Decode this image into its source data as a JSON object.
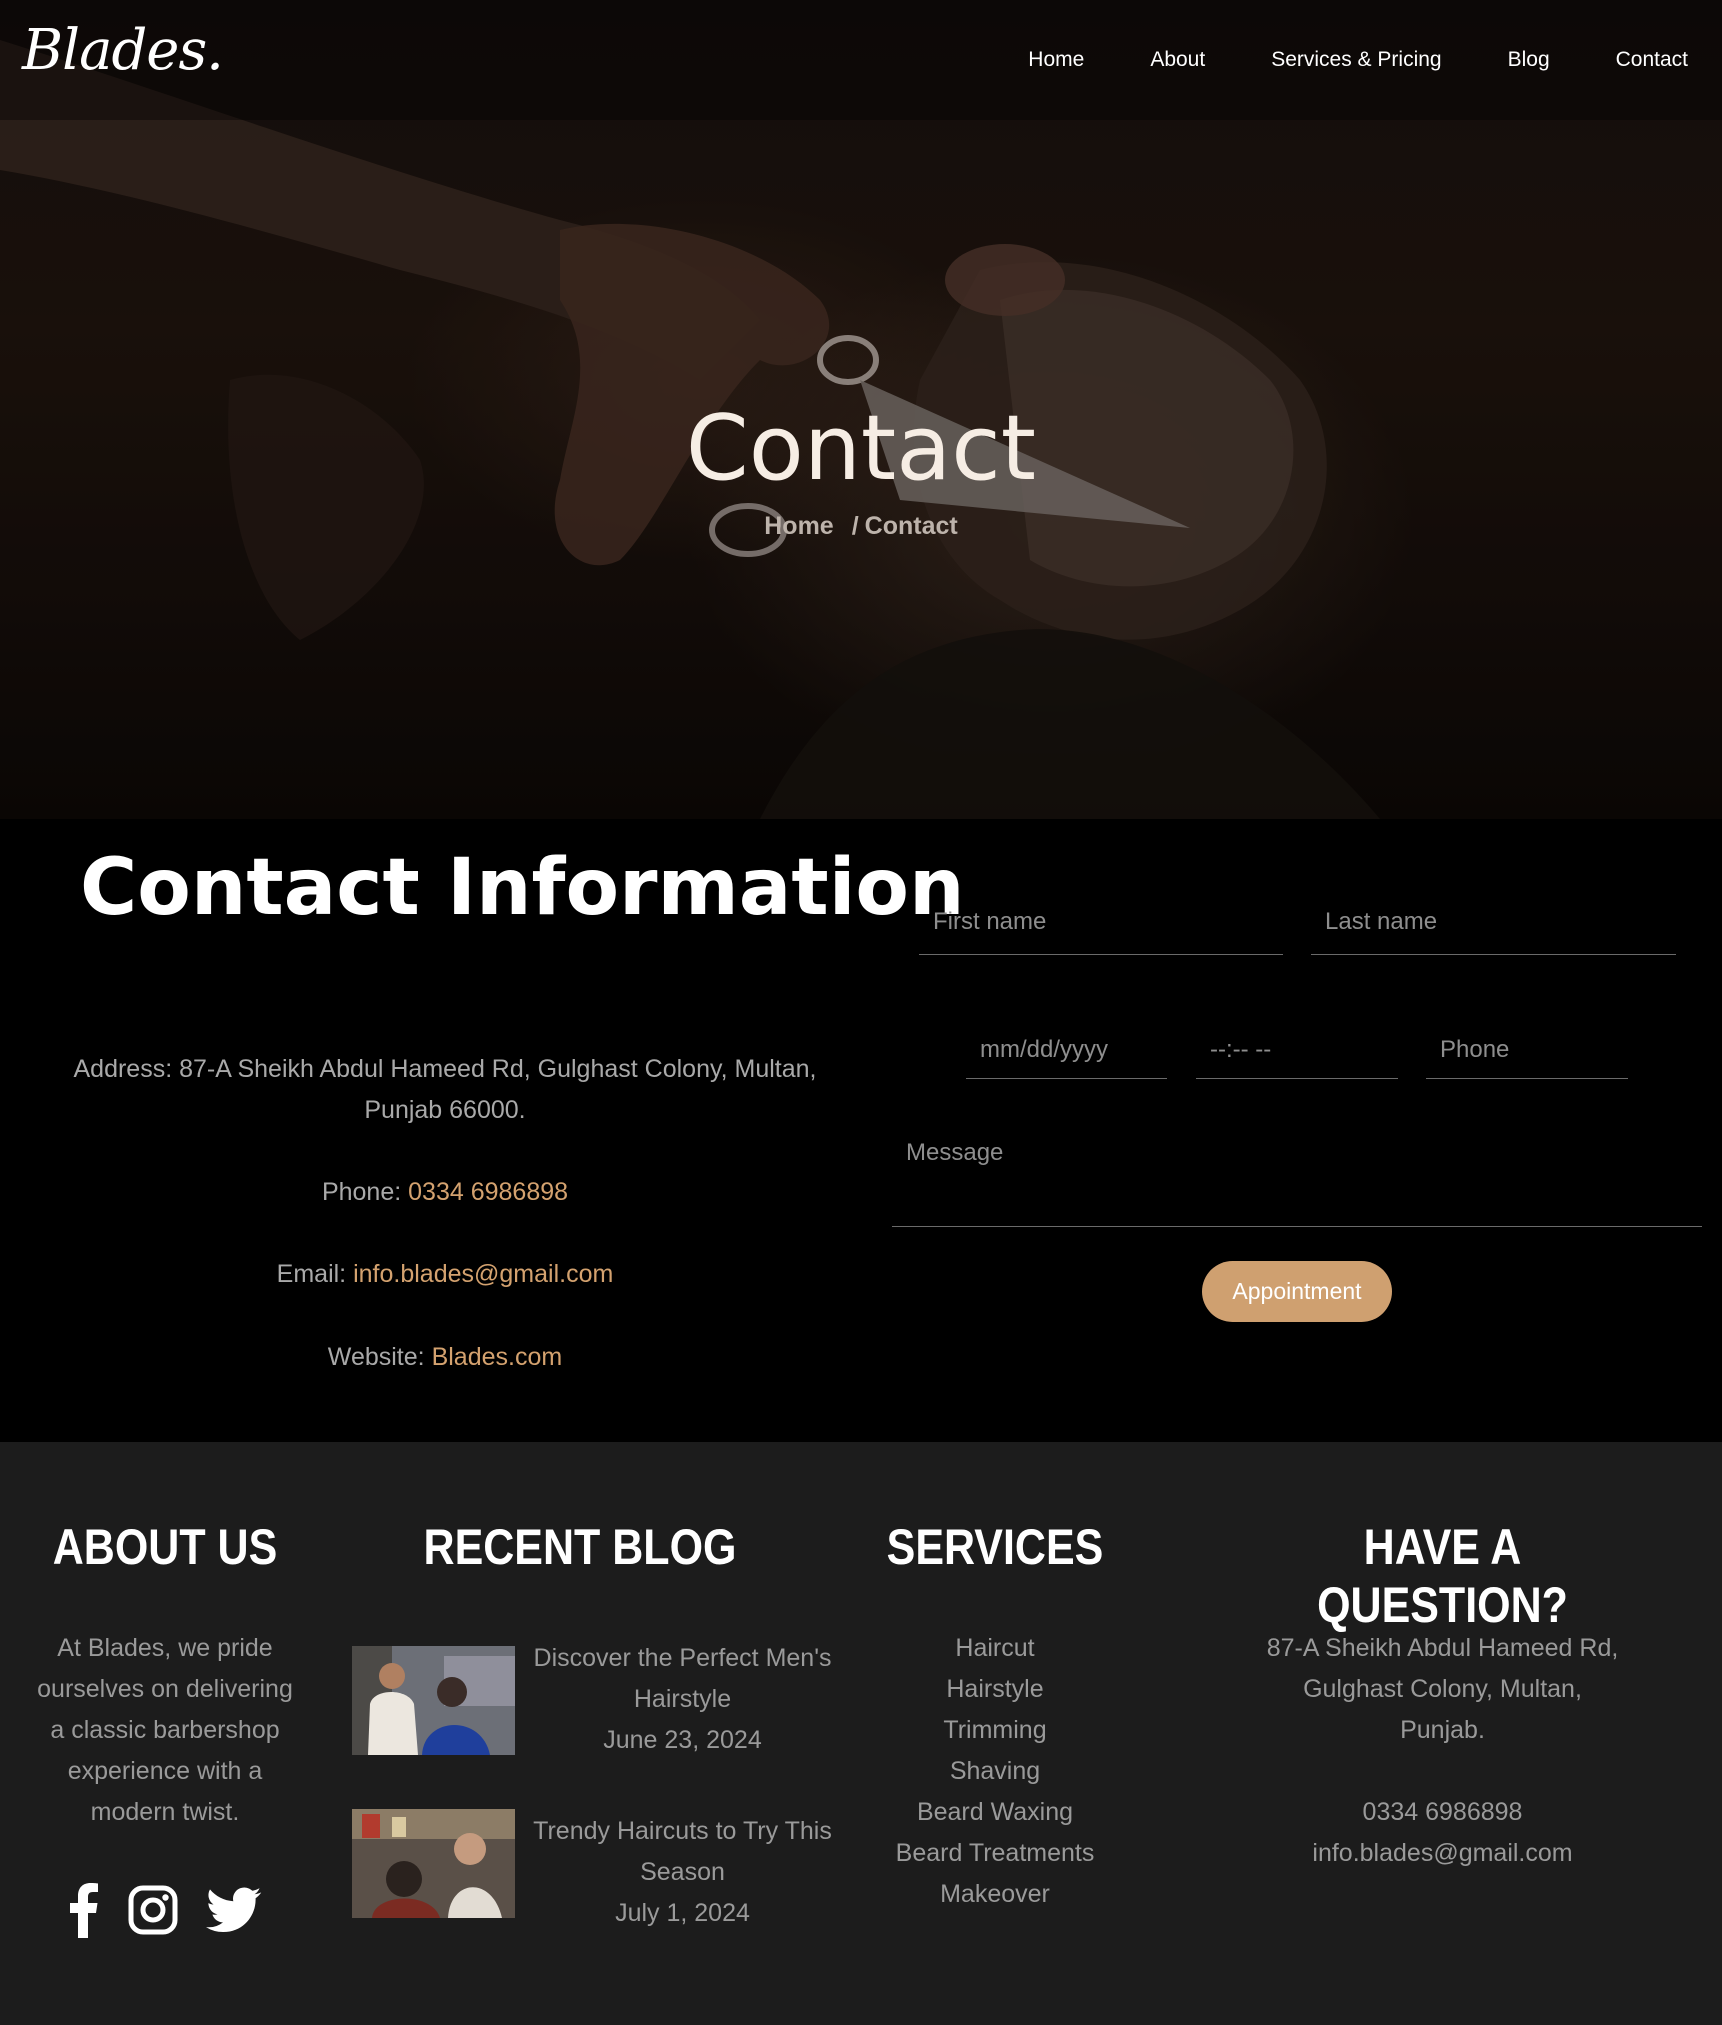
{
  "brand": {
    "logo": "Blades."
  },
  "nav": {
    "items": [
      "Home",
      "About",
      "Services & Pricing",
      "Blog",
      "Contact"
    ]
  },
  "hero": {
    "title": "Contact",
    "breadcrumb_home": "Home",
    "breadcrumb_sep": "/",
    "breadcrumb_current": "Contact"
  },
  "contact_info": {
    "title": "Contact Information",
    "address_line1": "Address: 87-A Sheikh Abdul Hameed Rd, Gulghast Colony, Multan,",
    "address_line2": "Punjab 66000.",
    "phone_label": "Phone:",
    "phone_value": "0334 6986898",
    "email_label": "Email:",
    "email_value": "info.blades@gmail.com",
    "website_label": "Website:",
    "website_value": "Blades.com"
  },
  "form": {
    "first_name_placeholder": "First name",
    "last_name_placeholder": "Last name",
    "date_placeholder": "mm/dd/yyyy",
    "time_placeholder": "--:-- --",
    "phone_placeholder": "Phone",
    "message_placeholder": "Message",
    "submit_label": "Appointment"
  },
  "footer": {
    "about": {
      "heading": "ABOUT US",
      "lines": [
        "At Blades, we pride",
        "ourselves on delivering",
        "a classic barbershop",
        "experience with a",
        "modern twist."
      ],
      "social_icons": [
        "facebook-icon",
        "instagram-icon",
        "twitter-icon"
      ]
    },
    "blog": {
      "heading": "RECENT BLOG",
      "posts": [
        {
          "title_line1": "Discover the Perfect Men's",
          "title_line2": "Hairstyle",
          "date": "June 23, 2024"
        },
        {
          "title_line1": "Trendy Haircuts to Try This",
          "title_line2": "Season",
          "date": "July 1, 2024"
        }
      ]
    },
    "services": {
      "heading": "SERVICES",
      "items": [
        "Haircut",
        "Hairstyle",
        "Trimming",
        "Shaving",
        "Beard Waxing",
        "Beard Treatments",
        "Makeover"
      ]
    },
    "question": {
      "heading": "HAVE A QUESTION?",
      "address_lines": [
        "87-A Sheikh Abdul Hameed Rd,",
        "Gulghast Colony, Multan,",
        "Punjab."
      ],
      "phone": "0334 6986898",
      "email": "info.blades@gmail.com"
    }
  },
  "colors": {
    "accent": "#d4a26f",
    "button": "#cfa070",
    "footer_bg": "#1c1c1c",
    "muted_text": "#9a9a9a"
  }
}
